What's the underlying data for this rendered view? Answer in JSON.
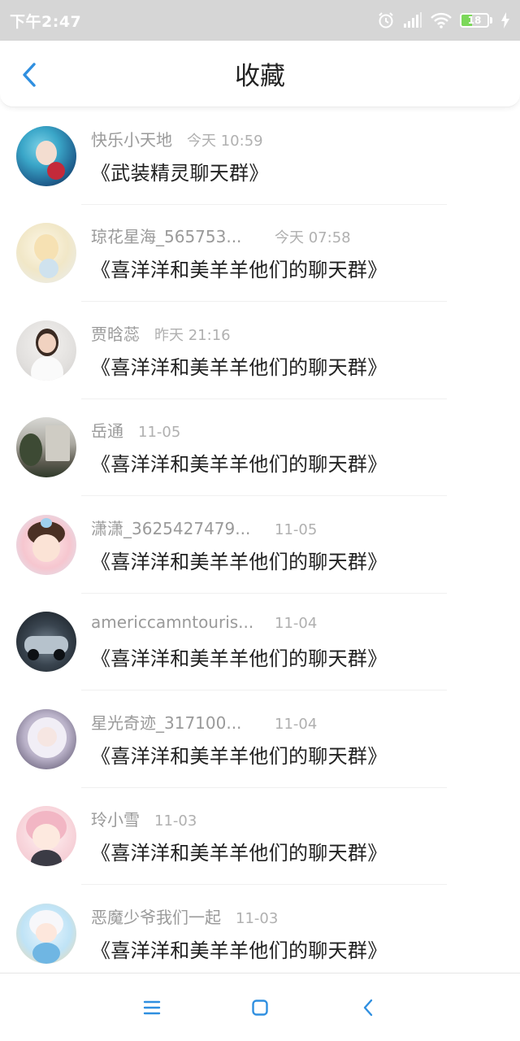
{
  "status_bar": {
    "time": "下午2:47",
    "battery_level": "18",
    "icons": [
      "alarm-icon",
      "signal-icon",
      "wifi-icon",
      "battery-icon",
      "charging-icon"
    ]
  },
  "header": {
    "title": "收藏",
    "back_icon": "back-chevron-icon"
  },
  "favorites": [
    {
      "sender": "快乐小天地",
      "time": "今天 10:59",
      "group": "《武装精灵聊天群》"
    },
    {
      "sender": "琼花星海_565753...",
      "time": "今天 07:58",
      "group": "《喜洋洋和美羊羊他们的聊天群》"
    },
    {
      "sender": "贾晗蕊",
      "time": "昨天 21:16",
      "group": "《喜洋洋和美羊羊他们的聊天群》"
    },
    {
      "sender": "岳通",
      "time": "11-05",
      "group": "《喜洋洋和美羊羊他们的聊天群》"
    },
    {
      "sender": "潇潇_3625427479...",
      "time": "11-05",
      "group": "《喜洋洋和美羊羊他们的聊天群》"
    },
    {
      "sender": "americcamntouris...",
      "time": "11-04",
      "group": "《喜洋洋和美羊羊他们的聊天群》"
    },
    {
      "sender": "星光奇迹_317100...",
      "time": "11-04",
      "group": "《喜洋洋和美羊羊他们的聊天群》"
    },
    {
      "sender": "玲小雪",
      "time": "11-03",
      "group": "《喜洋洋和美羊羊他们的聊天群》"
    },
    {
      "sender": "恶魔少爷我们一起",
      "time": "11-03",
      "group": "《喜洋洋和美羊羊他们的聊天群》"
    }
  ],
  "bottom_nav": {
    "icons": [
      "menu-icon",
      "home-icon",
      "back-icon"
    ]
  },
  "colors": {
    "accent": "#2f8fe0",
    "status_bar_bg": "#d6d6d6",
    "battery_fill": "#7cd85a"
  }
}
